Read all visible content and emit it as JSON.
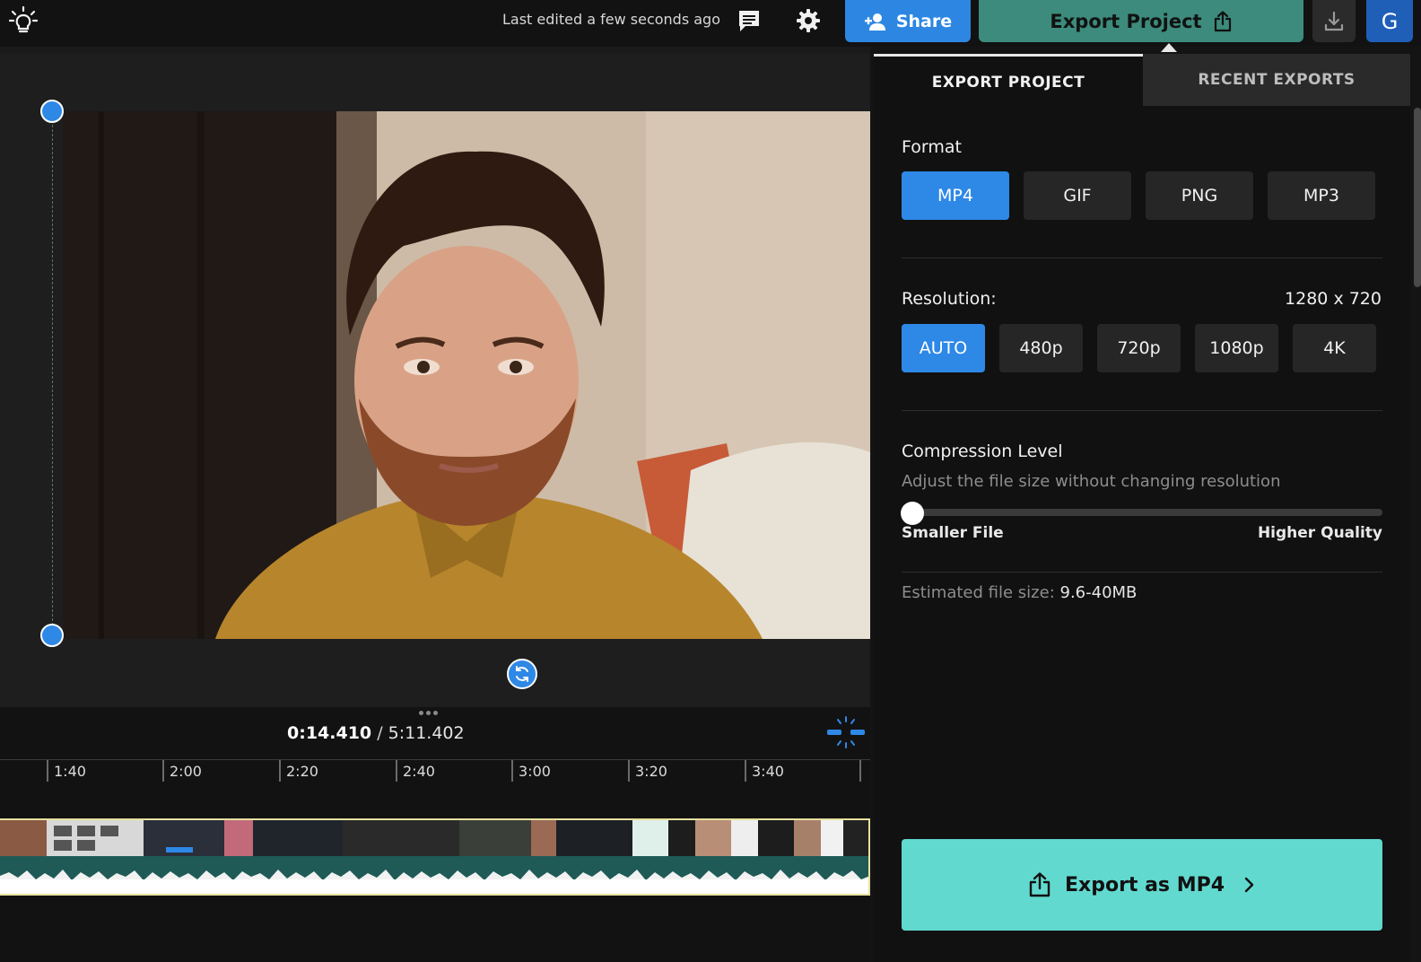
{
  "header": {
    "last_edited": "Last edited a few seconds ago",
    "share_label": "Share",
    "export_project_label": "Export Project",
    "avatar_initial": "G"
  },
  "timeline": {
    "current_time": "0:14.410",
    "separator": "/",
    "total_time": "5:11.402",
    "ruler_ticks": [
      "1:40",
      "2:00",
      "2:20",
      "2:40",
      "3:00",
      "3:20",
      "3:40"
    ]
  },
  "export_panel": {
    "tabs": [
      {
        "label": "EXPORT PROJECT",
        "active": true
      },
      {
        "label": "RECENT EXPORTS",
        "active": false
      }
    ],
    "format": {
      "label": "Format",
      "options": [
        "MP4",
        "GIF",
        "PNG",
        "MP3"
      ],
      "selected": "MP4"
    },
    "resolution": {
      "label": "Resolution:",
      "value": "1280 x 720",
      "options": [
        "AUTO",
        "480p",
        "720p",
        "1080p",
        "4K"
      ],
      "selected": "AUTO"
    },
    "compression": {
      "label": "Compression Level",
      "hint": "Adjust the file size without changing resolution",
      "min_label": "Smaller File",
      "max_label": "Higher Quality",
      "level": 0
    },
    "estimate": {
      "label": "Estimated file size:",
      "value": "9.6-40MB"
    },
    "export_button_label": "Export as MP4"
  },
  "colors": {
    "accent_blue": "#2e88e6",
    "export_teal": "#61d9cf",
    "export_project_green": "#3c8b7c"
  }
}
